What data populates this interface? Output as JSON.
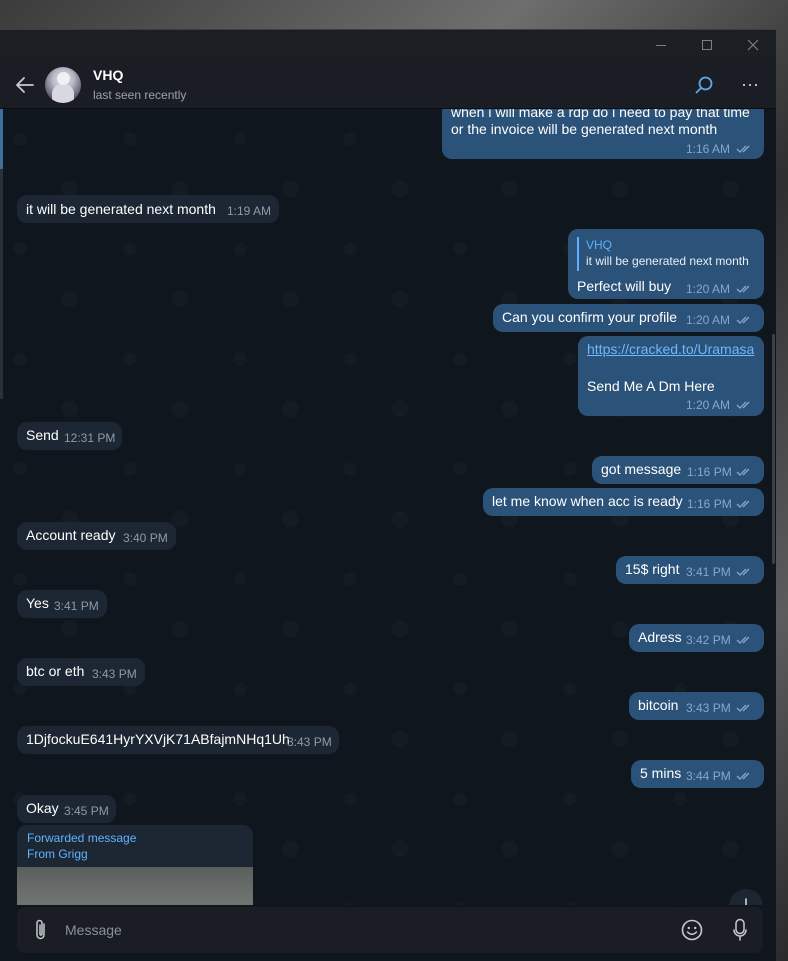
{
  "chat": {
    "name": "VHQ",
    "status": "last seen recently"
  },
  "messages": [
    {
      "dir": "out",
      "lines": [
        "when i will make a rdp do i need to pay that time",
        "or the invoice will be generated next month"
      ],
      "time": "1:16 AM"
    },
    {
      "dir": "in",
      "text": "it will be generated next month",
      "time": "1:19 AM"
    },
    {
      "dir": "out",
      "reply_name": "VHQ",
      "reply_text": "it will be generated next month",
      "text": "Perfect will buy",
      "time": "1:20 AM"
    },
    {
      "dir": "out",
      "text": "Can you confirm your profile",
      "time": "1:20 AM"
    },
    {
      "dir": "out",
      "link": "https://cracked.to/Uramasa",
      "text": "Send Me A Dm Here",
      "time": "1:20 AM"
    },
    {
      "dir": "in",
      "text": "Send",
      "time": "12:31 PM"
    },
    {
      "dir": "out",
      "text": "got message",
      "time": "1:16 PM"
    },
    {
      "dir": "out",
      "text": "let me know when acc is ready",
      "time": "1:16 PM"
    },
    {
      "dir": "in",
      "text": "Account ready",
      "time": "3:40 PM"
    },
    {
      "dir": "out",
      "text": "15$ right",
      "time": "3:41 PM"
    },
    {
      "dir": "in",
      "text": "Yes",
      "time": "3:41 PM"
    },
    {
      "dir": "out",
      "text": "Adress",
      "time": "3:42 PM"
    },
    {
      "dir": "in",
      "text": "btc or eth",
      "time": "3:43 PM"
    },
    {
      "dir": "out",
      "text": "bitcoin",
      "time": "3:43 PM"
    },
    {
      "dir": "in",
      "text": "1DjfockuE641HyrYXVjK71ABfajmNHq1Uh",
      "time": "3:43 PM"
    },
    {
      "dir": "out",
      "text": "5 mins",
      "time": "3:44 PM"
    },
    {
      "dir": "in",
      "text": "Okay",
      "time": "3:45 PM"
    }
  ],
  "forwarded": {
    "label": "Forwarded message",
    "from": "From Grigg"
  },
  "composer": {
    "placeholder": "Message"
  },
  "icons": {
    "back": "back-arrow-icon",
    "search": "search-icon",
    "more": "more-options-icon",
    "attach": "paperclip-icon",
    "emoji": "emoji-icon",
    "mic": "microphone-icon",
    "scroll_down": "arrow-down-icon"
  },
  "colors": {
    "incoming_bubble": "#1c2733",
    "outgoing_bubble": "#2b5278",
    "accent": "#5cb0ff",
    "background": "#0f161e"
  }
}
